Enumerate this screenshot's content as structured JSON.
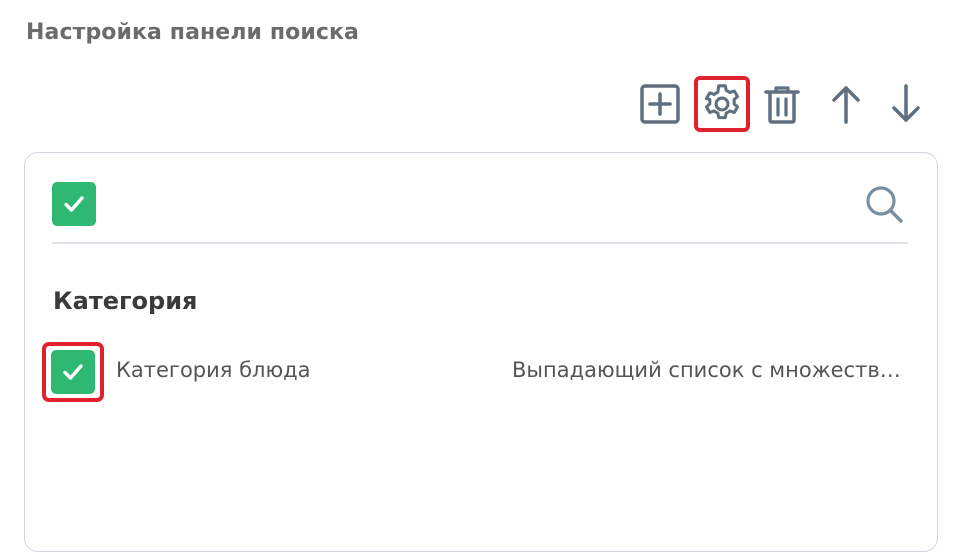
{
  "header": {
    "title": "Настройка панели поиска"
  },
  "toolbar": {
    "buttons": [
      {
        "icon": "plus-square-icon"
      },
      {
        "icon": "gear-icon",
        "highlighted": true
      },
      {
        "icon": "trash-icon"
      },
      {
        "icon": "arrow-up-icon"
      },
      {
        "icon": "arrow-down-icon"
      }
    ]
  },
  "panel": {
    "search": {
      "checked": true,
      "icon": "search-icon"
    },
    "section": {
      "heading": "Категория",
      "fields": [
        {
          "label": "Категория блюда",
          "type": "Выпадающий список с множественным выбором",
          "checked": true,
          "highlighted": true
        }
      ]
    }
  },
  "colors": {
    "accent": "#2eb872",
    "highlight": "#e0212e",
    "icon": "#5f6f80",
    "border": "#cfd6e0"
  }
}
